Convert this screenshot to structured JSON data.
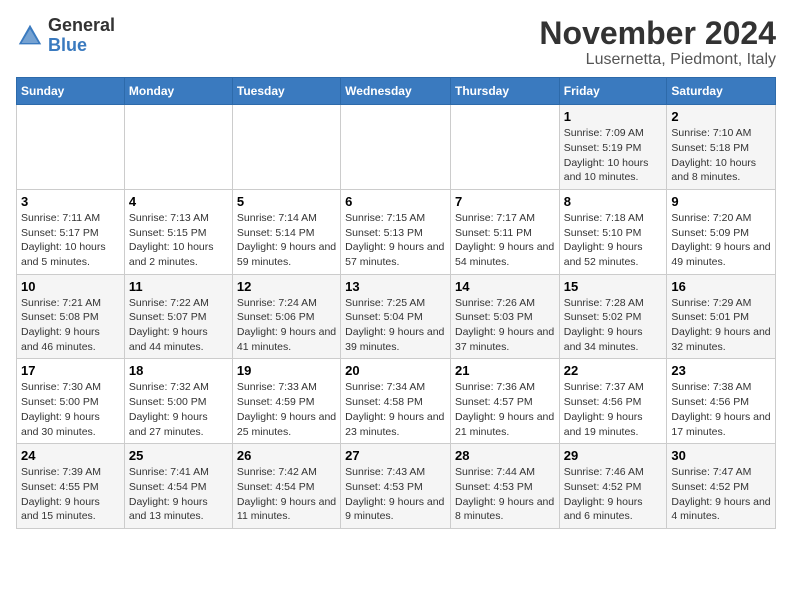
{
  "logo": {
    "general": "General",
    "blue": "Blue"
  },
  "title": "November 2024",
  "subtitle": "Lusernetta, Piedmont, Italy",
  "weekdays": [
    "Sunday",
    "Monday",
    "Tuesday",
    "Wednesday",
    "Thursday",
    "Friday",
    "Saturday"
  ],
  "weeks": [
    [
      {
        "day": "",
        "info": ""
      },
      {
        "day": "",
        "info": ""
      },
      {
        "day": "",
        "info": ""
      },
      {
        "day": "",
        "info": ""
      },
      {
        "day": "",
        "info": ""
      },
      {
        "day": "1",
        "info": "Sunrise: 7:09 AM\nSunset: 5:19 PM\nDaylight: 10 hours and 10 minutes."
      },
      {
        "day": "2",
        "info": "Sunrise: 7:10 AM\nSunset: 5:18 PM\nDaylight: 10 hours and 8 minutes."
      }
    ],
    [
      {
        "day": "3",
        "info": "Sunrise: 7:11 AM\nSunset: 5:17 PM\nDaylight: 10 hours and 5 minutes."
      },
      {
        "day": "4",
        "info": "Sunrise: 7:13 AM\nSunset: 5:15 PM\nDaylight: 10 hours and 2 minutes."
      },
      {
        "day": "5",
        "info": "Sunrise: 7:14 AM\nSunset: 5:14 PM\nDaylight: 9 hours and 59 minutes."
      },
      {
        "day": "6",
        "info": "Sunrise: 7:15 AM\nSunset: 5:13 PM\nDaylight: 9 hours and 57 minutes."
      },
      {
        "day": "7",
        "info": "Sunrise: 7:17 AM\nSunset: 5:11 PM\nDaylight: 9 hours and 54 minutes."
      },
      {
        "day": "8",
        "info": "Sunrise: 7:18 AM\nSunset: 5:10 PM\nDaylight: 9 hours and 52 minutes."
      },
      {
        "day": "9",
        "info": "Sunrise: 7:20 AM\nSunset: 5:09 PM\nDaylight: 9 hours and 49 minutes."
      }
    ],
    [
      {
        "day": "10",
        "info": "Sunrise: 7:21 AM\nSunset: 5:08 PM\nDaylight: 9 hours and 46 minutes."
      },
      {
        "day": "11",
        "info": "Sunrise: 7:22 AM\nSunset: 5:07 PM\nDaylight: 9 hours and 44 minutes."
      },
      {
        "day": "12",
        "info": "Sunrise: 7:24 AM\nSunset: 5:06 PM\nDaylight: 9 hours and 41 minutes."
      },
      {
        "day": "13",
        "info": "Sunrise: 7:25 AM\nSunset: 5:04 PM\nDaylight: 9 hours and 39 minutes."
      },
      {
        "day": "14",
        "info": "Sunrise: 7:26 AM\nSunset: 5:03 PM\nDaylight: 9 hours and 37 minutes."
      },
      {
        "day": "15",
        "info": "Sunrise: 7:28 AM\nSunset: 5:02 PM\nDaylight: 9 hours and 34 minutes."
      },
      {
        "day": "16",
        "info": "Sunrise: 7:29 AM\nSunset: 5:01 PM\nDaylight: 9 hours and 32 minutes."
      }
    ],
    [
      {
        "day": "17",
        "info": "Sunrise: 7:30 AM\nSunset: 5:00 PM\nDaylight: 9 hours and 30 minutes."
      },
      {
        "day": "18",
        "info": "Sunrise: 7:32 AM\nSunset: 5:00 PM\nDaylight: 9 hours and 27 minutes."
      },
      {
        "day": "19",
        "info": "Sunrise: 7:33 AM\nSunset: 4:59 PM\nDaylight: 9 hours and 25 minutes."
      },
      {
        "day": "20",
        "info": "Sunrise: 7:34 AM\nSunset: 4:58 PM\nDaylight: 9 hours and 23 minutes."
      },
      {
        "day": "21",
        "info": "Sunrise: 7:36 AM\nSunset: 4:57 PM\nDaylight: 9 hours and 21 minutes."
      },
      {
        "day": "22",
        "info": "Sunrise: 7:37 AM\nSunset: 4:56 PM\nDaylight: 9 hours and 19 minutes."
      },
      {
        "day": "23",
        "info": "Sunrise: 7:38 AM\nSunset: 4:56 PM\nDaylight: 9 hours and 17 minutes."
      }
    ],
    [
      {
        "day": "24",
        "info": "Sunrise: 7:39 AM\nSunset: 4:55 PM\nDaylight: 9 hours and 15 minutes."
      },
      {
        "day": "25",
        "info": "Sunrise: 7:41 AM\nSunset: 4:54 PM\nDaylight: 9 hours and 13 minutes."
      },
      {
        "day": "26",
        "info": "Sunrise: 7:42 AM\nSunset: 4:54 PM\nDaylight: 9 hours and 11 minutes."
      },
      {
        "day": "27",
        "info": "Sunrise: 7:43 AM\nSunset: 4:53 PM\nDaylight: 9 hours and 9 minutes."
      },
      {
        "day": "28",
        "info": "Sunrise: 7:44 AM\nSunset: 4:53 PM\nDaylight: 9 hours and 8 minutes."
      },
      {
        "day": "29",
        "info": "Sunrise: 7:46 AM\nSunset: 4:52 PM\nDaylight: 9 hours and 6 minutes."
      },
      {
        "day": "30",
        "info": "Sunrise: 7:47 AM\nSunset: 4:52 PM\nDaylight: 9 hours and 4 minutes."
      }
    ]
  ]
}
